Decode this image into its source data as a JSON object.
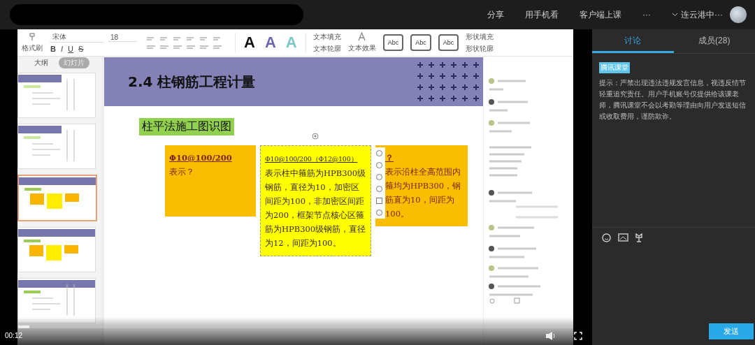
{
  "topbar": {
    "actions": [
      "分享",
      "用手机看",
      "客户端上课",
      "···"
    ],
    "account": "连云港中···"
  },
  "toolbar": {
    "clipboard_label": "格式刷",
    "font": "宋体",
    "font_size": "18",
    "format_buttons": [
      "B",
      "I",
      "U",
      "S"
    ],
    "style_letters": [
      {
        "label": "A",
        "color": "#111111"
      },
      {
        "label": "A",
        "color": "#6a68a8"
      },
      {
        "label": "A",
        "color": "#7cc6c8"
      }
    ],
    "text_commands": [
      "文本填充",
      "文本轮廓"
    ],
    "text_effect": "文本效果",
    "shape_styles": [
      "Abc",
      "Abc",
      "Abc"
    ],
    "shape_commands": [
      "形状填充",
      "形状轮廓"
    ]
  },
  "view_tabs": [
    {
      "label": "大纲",
      "selected": false
    },
    {
      "label": "幻灯片",
      "selected": true
    }
  ],
  "thumbnails": [
    {
      "selected": false
    },
    {
      "selected": false
    },
    {
      "selected": true
    },
    {
      "selected": false
    },
    {
      "selected": false
    }
  ],
  "slide": {
    "title": "2.4  柱钢筋工程计量",
    "subtitle": "柱平法施工图识图",
    "boxes": [
      {
        "kind": "question",
        "heading": "Φ10@100/200",
        "body": "表示？"
      },
      {
        "kind": "answer",
        "heading": "Φ10@100/200（Φ12@100）",
        "body": "表示柱中箍筋为HPB300级钢筋，直径为10，加密区间距为100，非加密区间距为200，框架节点核心区箍筋为HPB300级钢筋，直径为12，间距为100。"
      },
      {
        "kind": "covered",
        "heading": "？",
        "body": "表示沿柱全高范围内箍均为HPB300，钢筋直为10，间距为100。"
      }
    ]
  },
  "player": {
    "time": "00:12",
    "level": 0.02
  },
  "panel": {
    "tabs": [
      {
        "label": "讨论",
        "selected": true
      },
      {
        "label": "成员(28)",
        "selected": false
      }
    ],
    "badge": "腾讯课堂",
    "notice": "提示：严禁出现违法违规发言信息，视违反情节轻重追究责任。用户手机账号仅提供给该课老师，腾讯课堂不会以考勤等理由向用户发送短信或收取费用，谨防欺诈。",
    "send_button": "发送"
  }
}
